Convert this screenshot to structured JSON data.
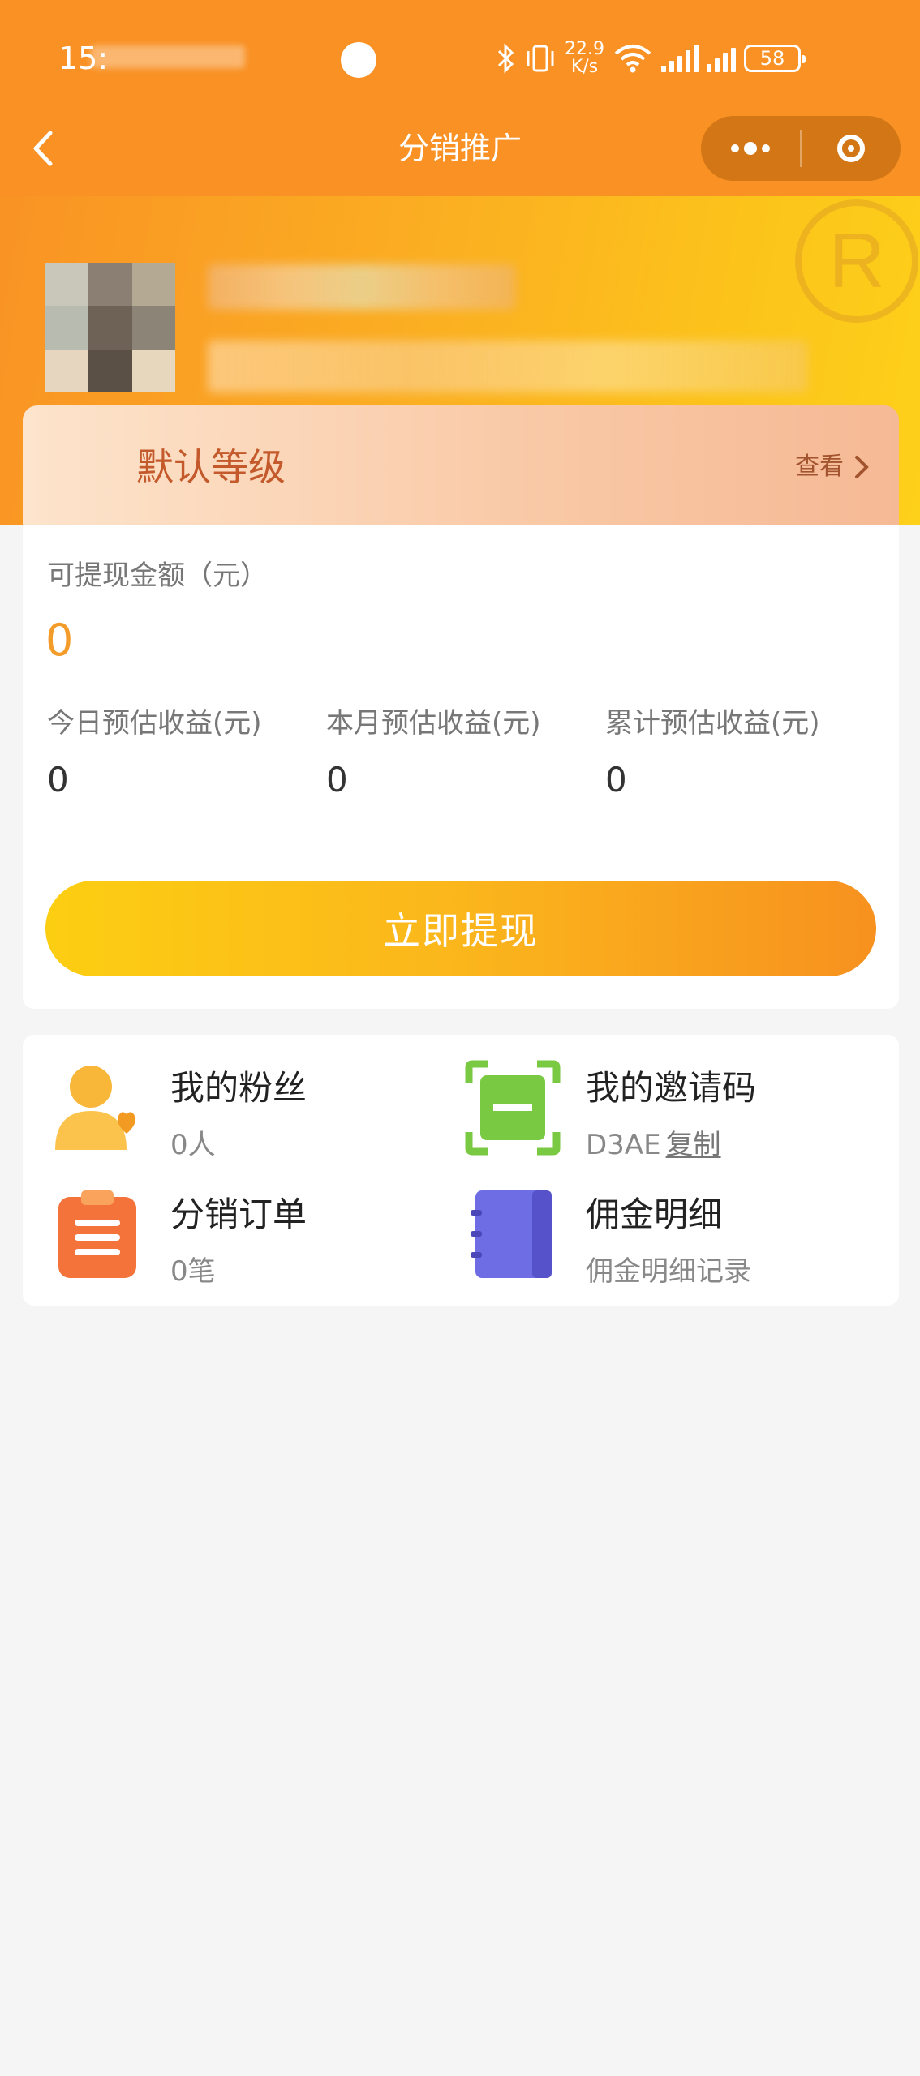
{
  "status_bar": {
    "time": "15:",
    "net_speed": "22.9",
    "net_unit": "K/s",
    "battery": "58"
  },
  "nav": {
    "title": "分销推广"
  },
  "level": {
    "name": "默认等级",
    "view_label": "查看"
  },
  "balance": {
    "label": "可提现金额（元）",
    "value": "0",
    "stats": [
      {
        "label": "今日预估收益(元)",
        "value": "0"
      },
      {
        "label": "本月预估收益(元)",
        "value": "0"
      },
      {
        "label": "累计预估收益(元)",
        "value": "0"
      }
    ],
    "withdraw_button": "立即提现"
  },
  "menu": {
    "items": [
      {
        "title": "我的粉丝",
        "sub": "0人",
        "icon": "fans-icon"
      },
      {
        "title": "我的邀请码",
        "sub": "D3AE",
        "link": "复制",
        "icon": "invite-code-icon"
      },
      {
        "title": "分销订单",
        "sub": "0笔",
        "icon": "order-clipboard-icon"
      },
      {
        "title": "佣金明细",
        "sub": "佣金明细记录",
        "icon": "commission-notebook-icon"
      }
    ]
  },
  "colors": {
    "primary_orange": "#f99124",
    "accent_yellow": "#fcce12",
    "value_orange": "#f39c2a",
    "level_text": "#c45a2c"
  }
}
